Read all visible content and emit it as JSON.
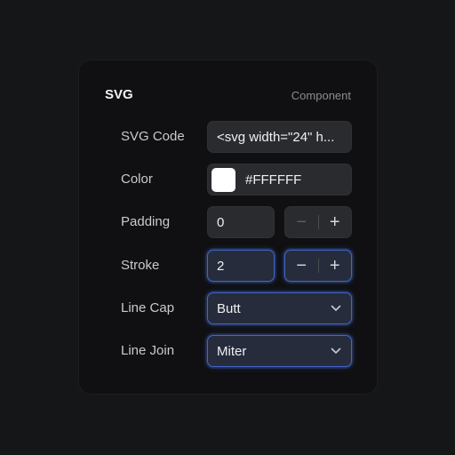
{
  "panel": {
    "title": "SVG",
    "tag": "Component"
  },
  "rows": {
    "svg_code": {
      "label": "SVG Code",
      "value": "<svg width=\"24\" h..."
    },
    "color": {
      "label": "Color",
      "value": "#FFFFFF",
      "swatch": "#FFFFFF"
    },
    "padding": {
      "label": "Padding",
      "value": "0",
      "minus": "−",
      "plus": "+"
    },
    "stroke": {
      "label": "Stroke",
      "value": "2",
      "minus": "−",
      "plus": "+"
    },
    "line_cap": {
      "label": "Line Cap",
      "value": "Butt",
      "icon": "chevron-down-icon"
    },
    "line_join": {
      "label": "Line Join",
      "value": "Miter",
      "icon": "chevron-down-icon"
    }
  },
  "colors": {
    "accent": "#4366c9",
    "panel": "#101012",
    "field": "#2a2b2e"
  }
}
